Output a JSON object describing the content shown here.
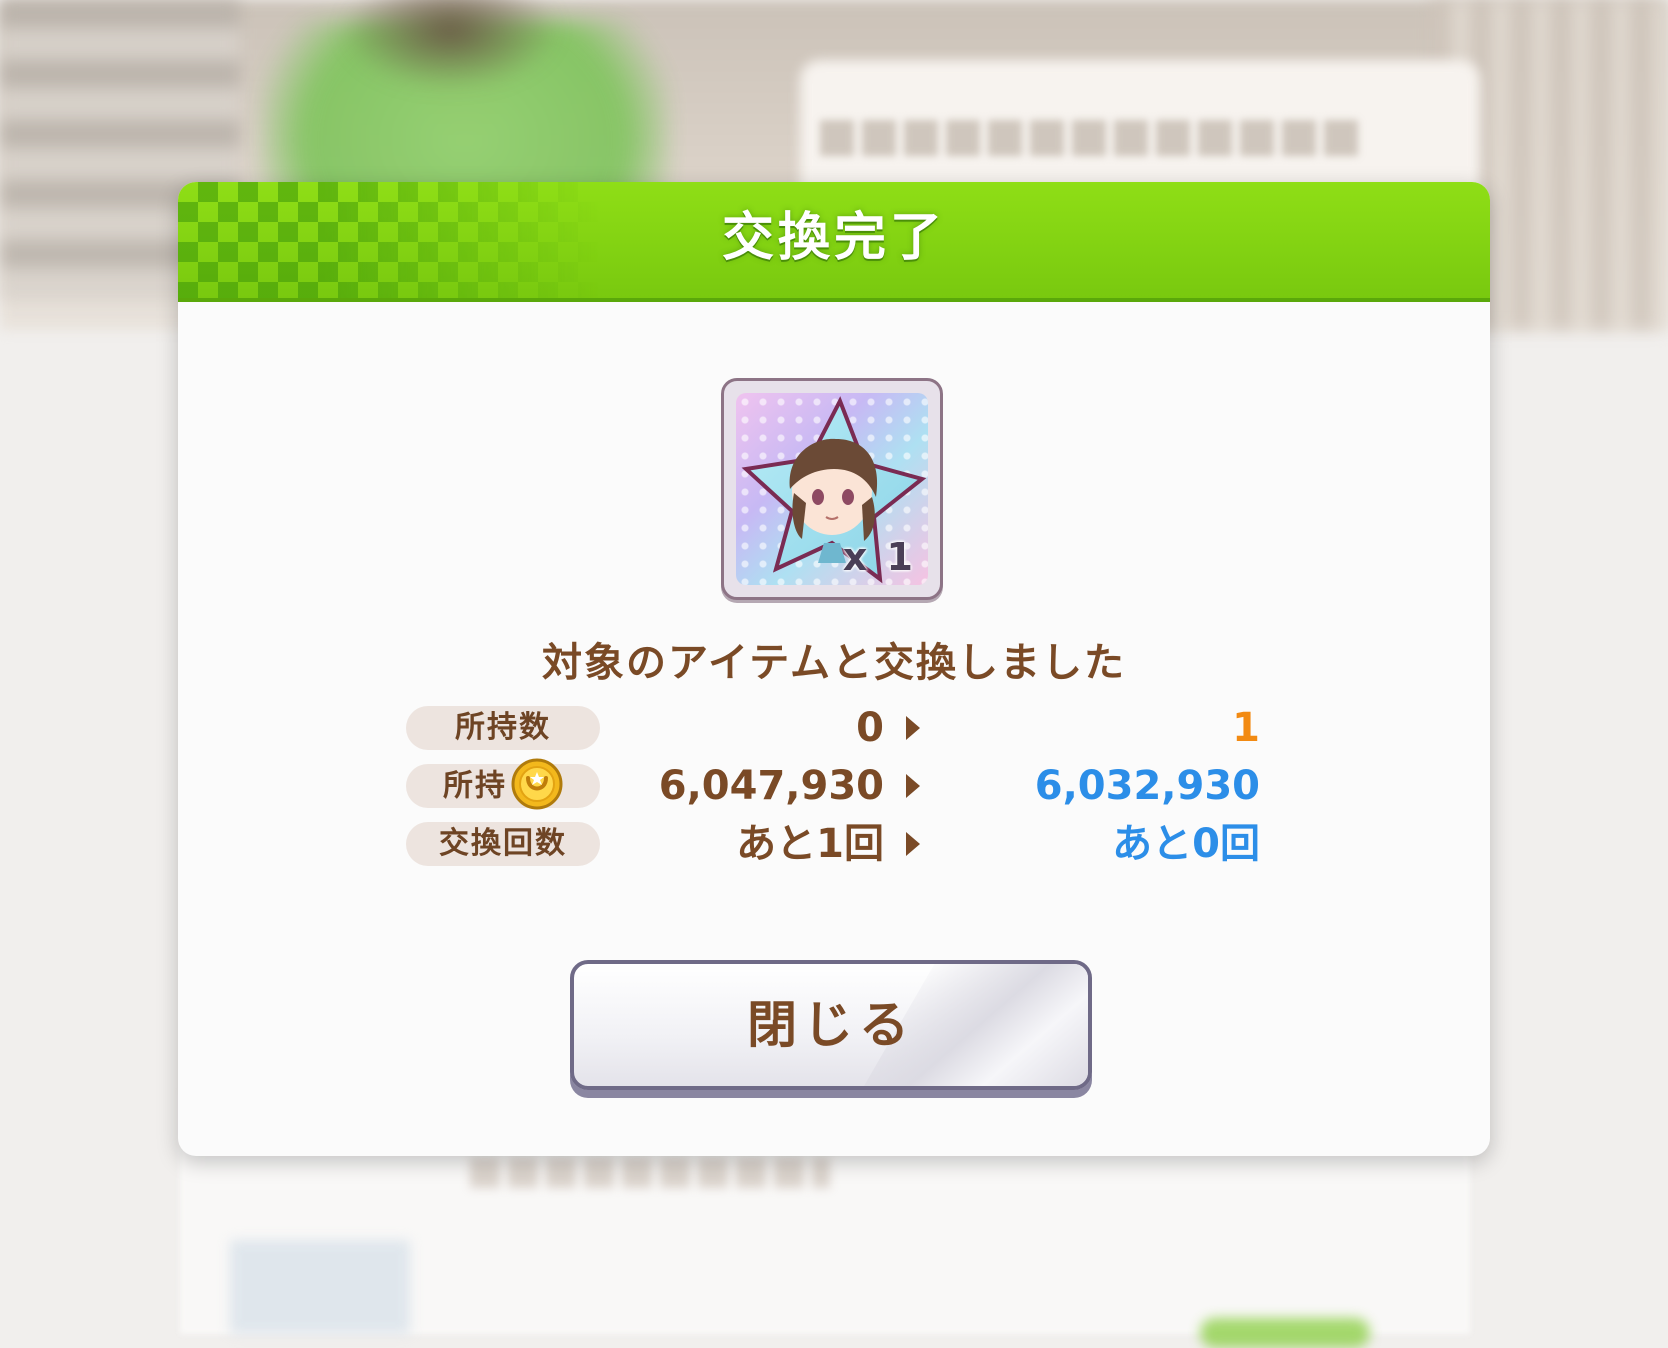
{
  "modal": {
    "title": "交換完了",
    "message": "対象のアイテムと交換しました",
    "close_label": "閉じる"
  },
  "item": {
    "icon": "character-piece-star-icon",
    "quantity_label": "x 1"
  },
  "stats": [
    {
      "label": "所持数",
      "icon": null,
      "before": "0",
      "after": "1",
      "after_color": "#f28a12"
    },
    {
      "label": "所持",
      "icon": "gold-coin-icon",
      "before": "6,047,930",
      "after": "6,032,930",
      "after_color": "#2c8ee8"
    },
    {
      "label": "交換回数",
      "icon": null,
      "before": "あと1回",
      "after": "あと0回",
      "after_color": "#2c8ee8"
    }
  ],
  "colors": {
    "header_green": "#8fde16",
    "text_brown": "#7a4a26",
    "accent_orange": "#f28a12",
    "accent_blue": "#2c8ee8"
  }
}
